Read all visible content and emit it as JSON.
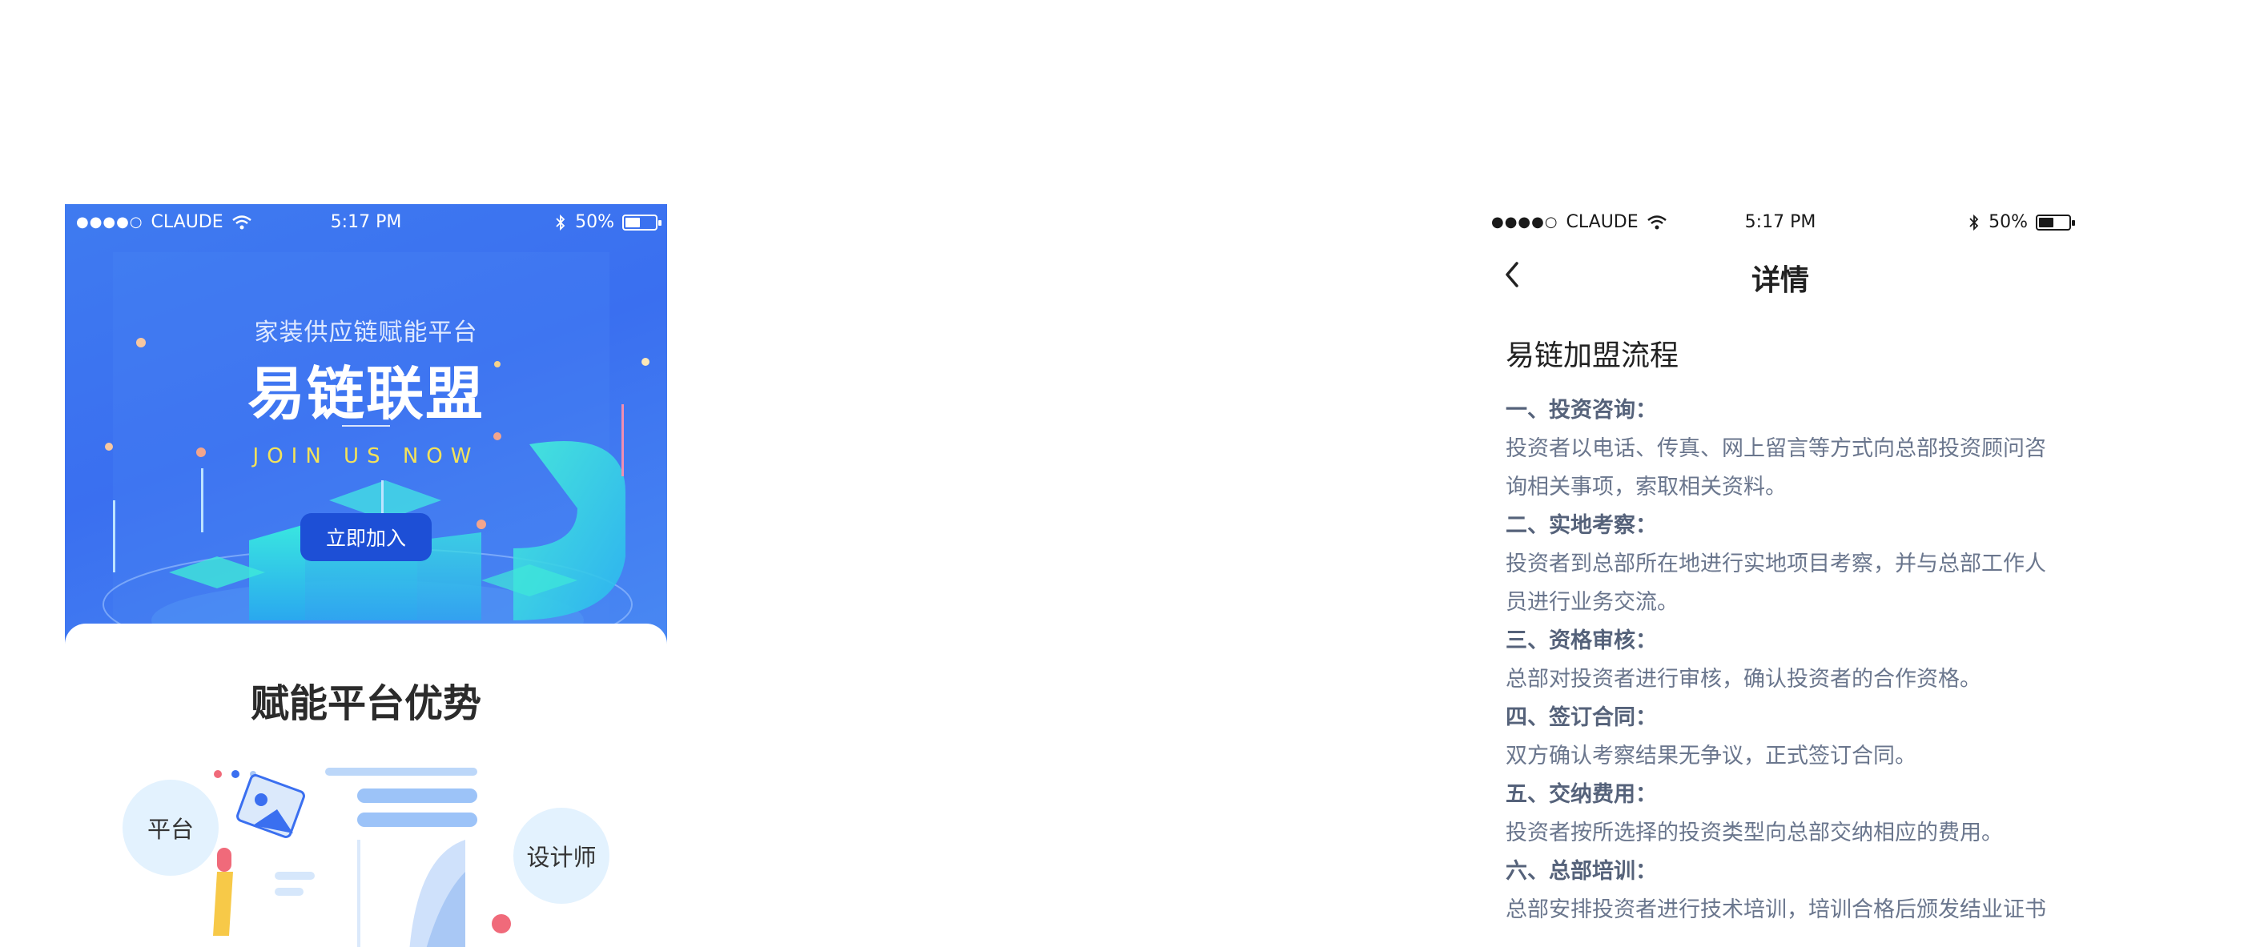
{
  "status_bar": {
    "signal": "●●●●○",
    "carrier": "CLAUDE",
    "time": "5:17 PM",
    "battery": "50%",
    "battery_level": 0.5
  },
  "left": {
    "hero": {
      "subtitle": "家装供应链赋能平台",
      "title": "易链联盟",
      "tagline": "JOIN US NOW",
      "join_button": "立即加入"
    },
    "section_title": "赋能平台优势",
    "bubbles": [
      "平台",
      "设计师"
    ]
  },
  "right": {
    "nav_title": "详情",
    "article_title": "易链加盟流程",
    "sections": [
      {
        "heading": "一、投资咨询：",
        "body": "投资者以电话、传真、网上留言等方式向总部投资顾问咨询相关事项，索取相关资料。"
      },
      {
        "heading": "二、实地考察：",
        "body": "投资者到总部所在地进行实地项目考察，并与总部工作人员进行业务交流。"
      },
      {
        "heading": "三、资格审核：",
        "body": "总部对投资者进行审核，确认投资者的合作资格。"
      },
      {
        "heading": "四、签订合同：",
        "body": "双方确认考察结果无争议，正式签订合同。"
      },
      {
        "heading": "五、交纳费用：",
        "body": "投资者按所选择的投资类型向总部交纳相应的费用。"
      },
      {
        "heading": "六、总部培训：",
        "body": "总部安排投资者进行技术培训，培训合格后颁发结业证书"
      }
    ]
  },
  "colors": {
    "hero_blue": "#3f7bf0",
    "button_blue": "#1d4fd6",
    "tagline_yellow": "#f3e25a",
    "cyan_accent": "#34e0dc",
    "heading_gray": "#55627a",
    "body_gray": "#6a768d"
  }
}
